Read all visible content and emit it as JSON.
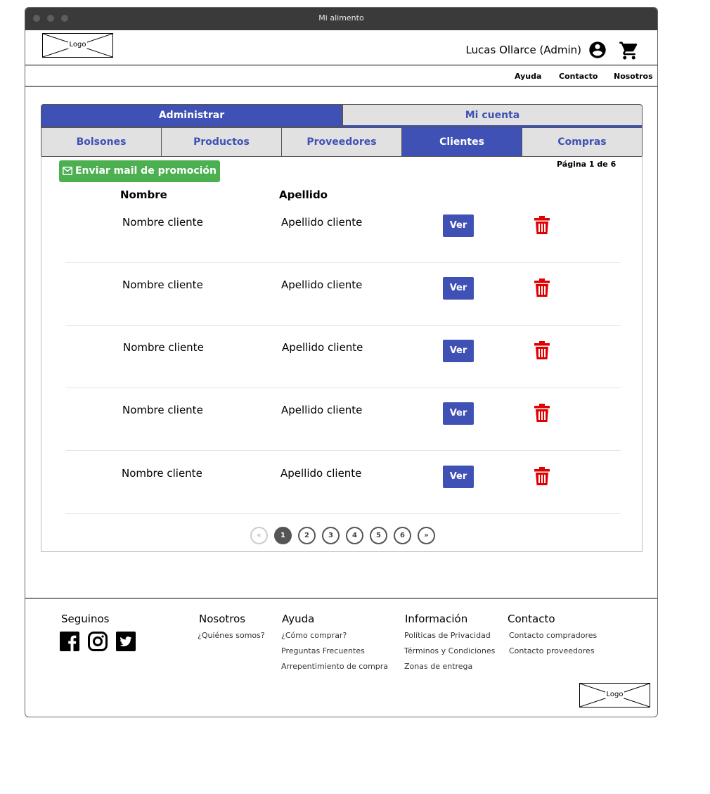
{
  "window": {
    "title": "Mi alimento"
  },
  "header": {
    "logo_label": "Logo",
    "user_name": "Lucas Ollarce (Admin)",
    "user_icon": "account-circle-icon",
    "cart_icon": "shopping-cart-icon"
  },
  "nav": {
    "items": [
      "Ayuda",
      "Contacto",
      "Nosotros"
    ]
  },
  "top_tabs": [
    {
      "label": "Administrar",
      "active": true
    },
    {
      "label": "Mi cuenta",
      "active": false
    }
  ],
  "sub_tabs": [
    {
      "label": "Bolsones",
      "active": false
    },
    {
      "label": "Productos",
      "active": false
    },
    {
      "label": "Proveedores",
      "active": false
    },
    {
      "label": "Clientes",
      "active": true
    },
    {
      "label": "Compras",
      "active": false
    }
  ],
  "promo_button": {
    "label": "Enviar mail de promoción",
    "icon": "envelope-icon"
  },
  "page_info": "Página 1 de 6",
  "table": {
    "columns": [
      "Nombre",
      "Apellido"
    ],
    "rows": [
      {
        "nombre": "Nombre cliente",
        "apellido": "Apellido cliente",
        "action": "Ver"
      },
      {
        "nombre": "Nombre cliente",
        "apellido": "Apellido cliente",
        "action": "Ver"
      },
      {
        "nombre": "Nombre cliente",
        "apellido": "Apellido cliente",
        "action": "Ver"
      },
      {
        "nombre": "Nombre cliente",
        "apellido": "Apellido cliente",
        "action": "Ver"
      },
      {
        "nombre": "Nombre cliente",
        "apellido": "Apellido cliente",
        "action": "Ver"
      }
    ],
    "delete_icon": "trash-icon",
    "delete_color": "#e00000"
  },
  "pagination": {
    "pages": [
      "1",
      "2",
      "3",
      "4",
      "5",
      "6"
    ],
    "current": "1",
    "first_icon": "double-chevron-left-icon",
    "last_icon": "double-chevron-right-icon"
  },
  "footer": {
    "columns": [
      {
        "heading": "Seguinos",
        "links": []
      },
      {
        "heading": "Nosotros",
        "links": [
          "¿Quiénes somos?"
        ]
      },
      {
        "heading": "Ayuda",
        "links": [
          "¿Cómo comprar?",
          "Preguntas Frecuentes",
          "Arrepentimiento de compra"
        ]
      },
      {
        "heading": "Información",
        "links": [
          "Políticas de Privacidad",
          "Términos y Condiciones",
          "Zonas de entrega"
        ]
      },
      {
        "heading": "Contacto",
        "links": [
          "Contacto compradores",
          "Contacto proveedores"
        ]
      }
    ],
    "social_icons": [
      "facebook-icon",
      "instagram-icon",
      "twitter-icon"
    ],
    "logo_label": "Logo"
  },
  "colors": {
    "primary": "#3f51b5",
    "success": "#4caf50",
    "danger": "#e00000",
    "tab_inactive_bg": "#e1e1e1",
    "titlebar_bg": "#3a3a3a"
  }
}
